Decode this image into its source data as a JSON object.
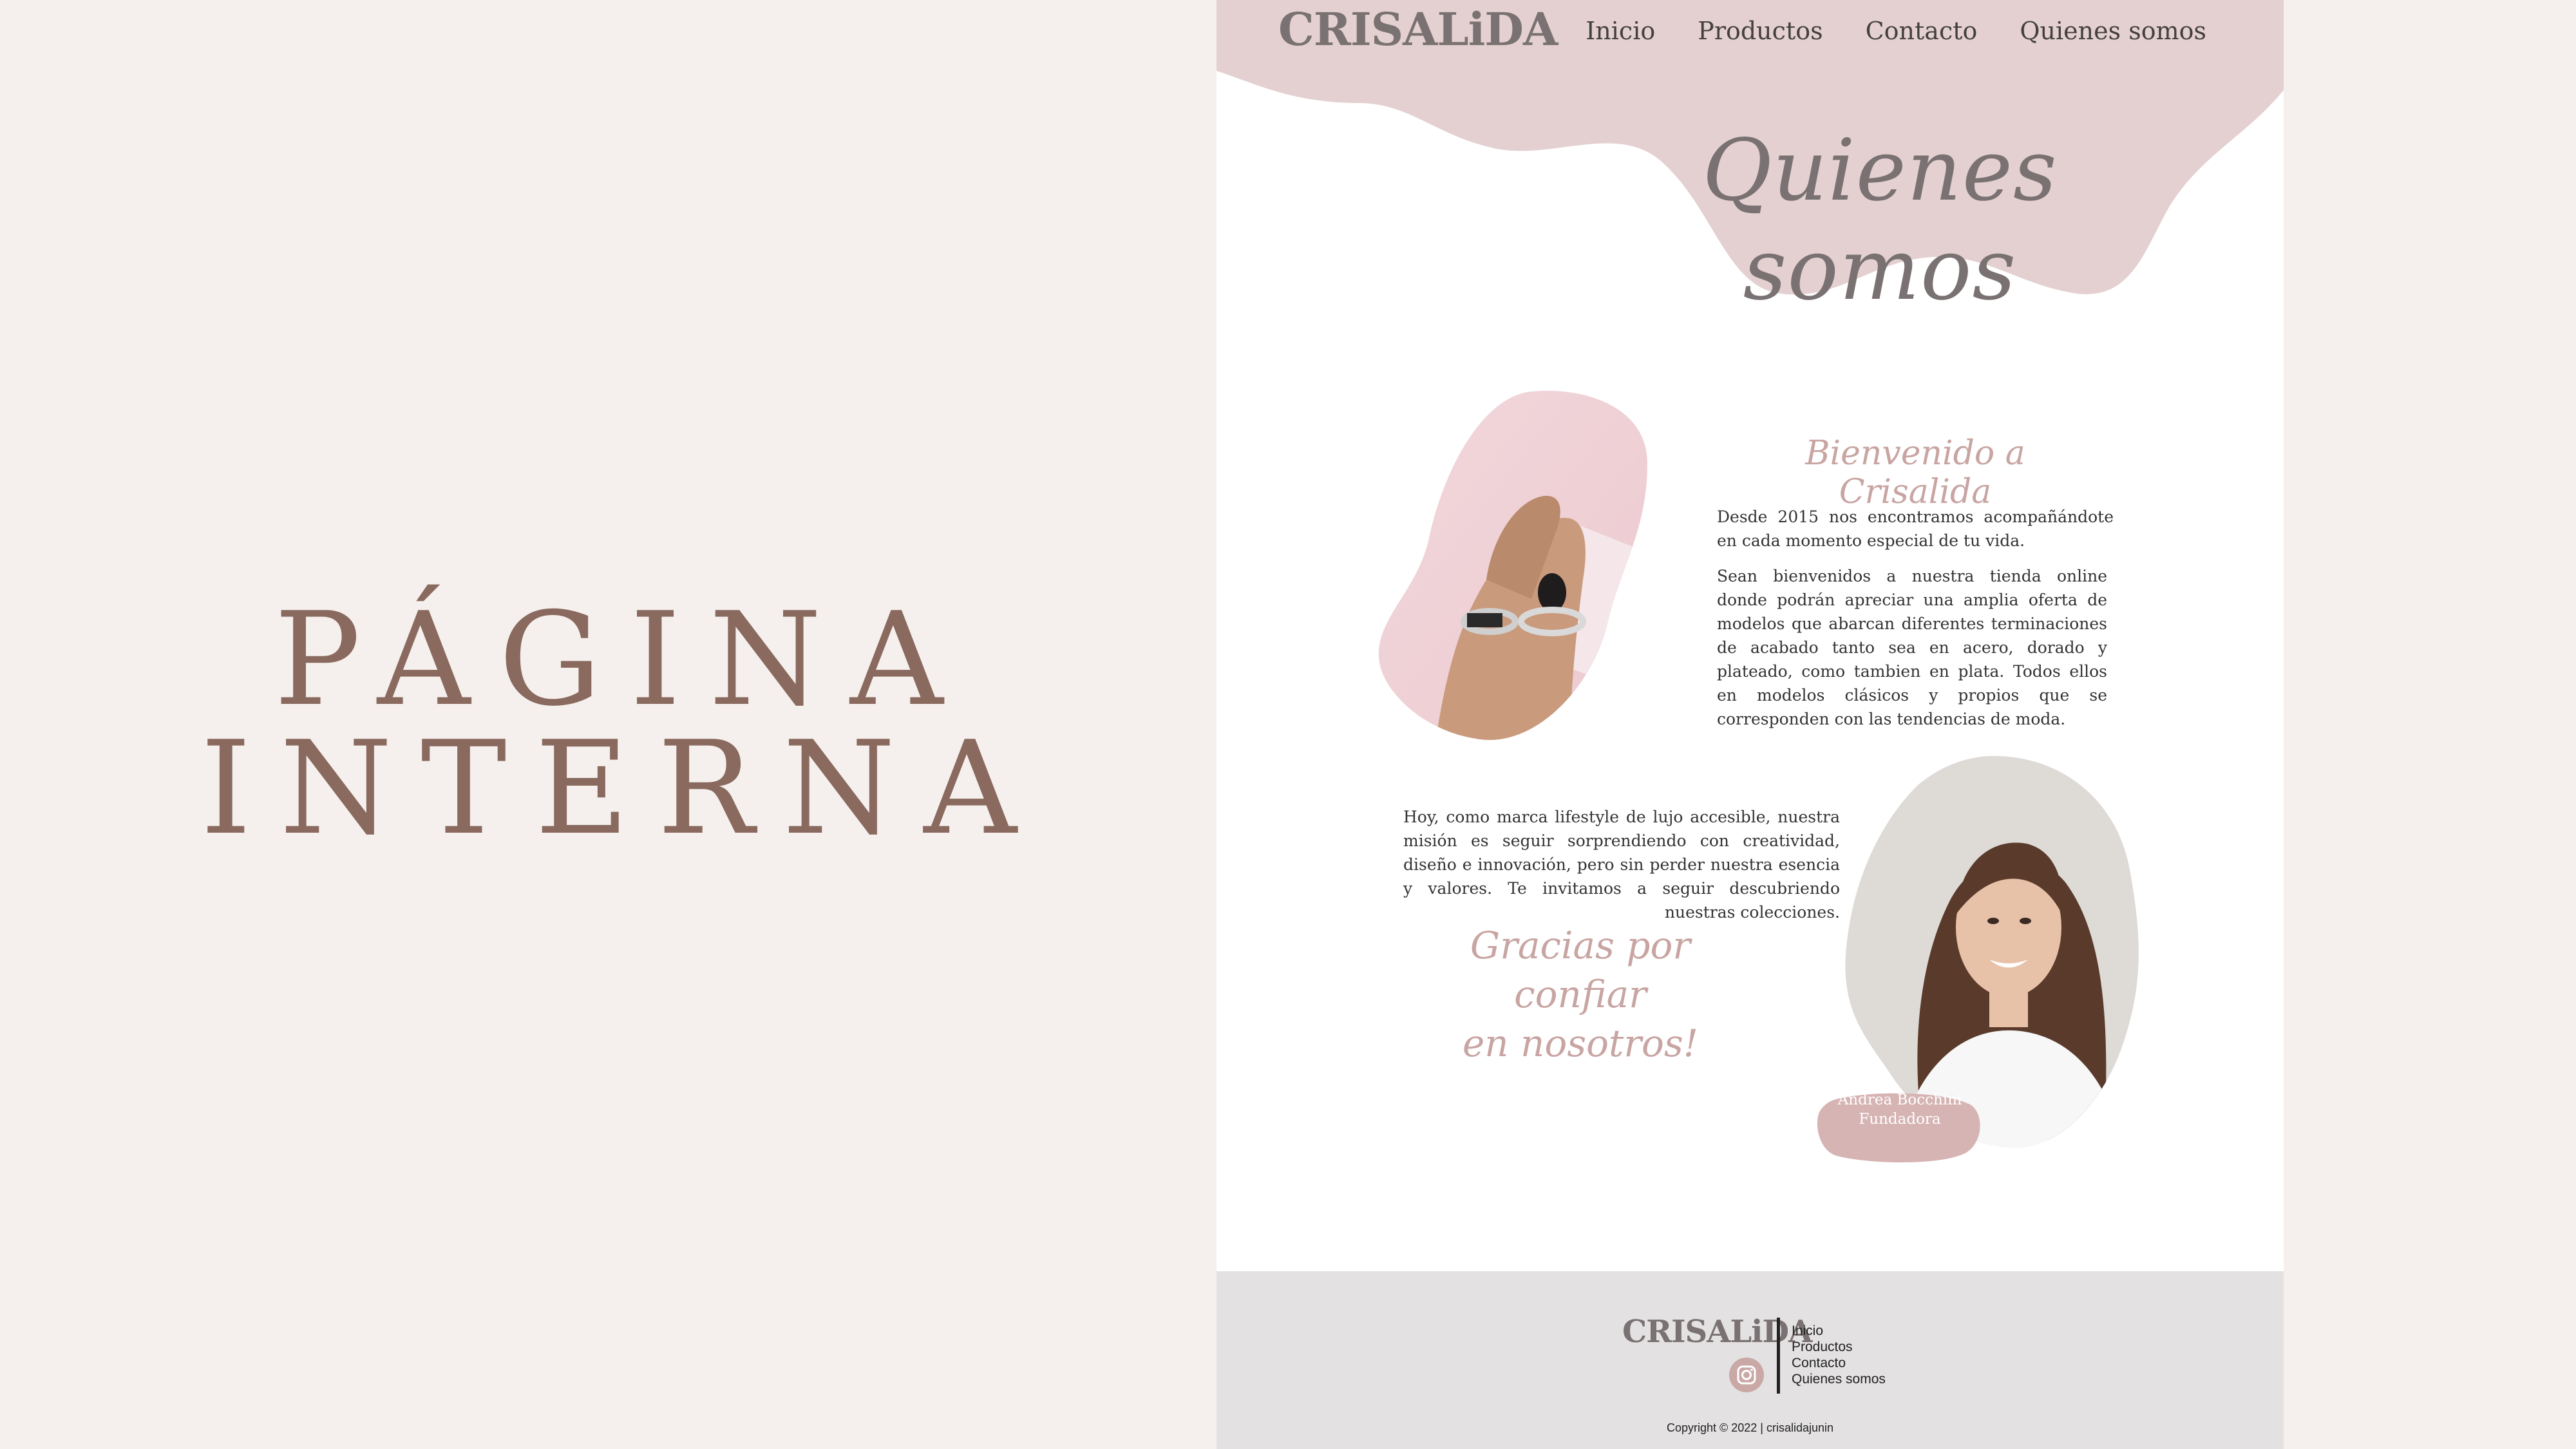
{
  "slide": {
    "title_line1": "PÁGINA",
    "title_line2": "INTERNA"
  },
  "site": {
    "logo": "CRISALiDA",
    "nav": [
      "Inicio",
      "Productos",
      "Contacto",
      "Quienes somos"
    ],
    "hero_title": "Quienes somos",
    "welcome_heading": "Bienvenido a Crisalida",
    "paragraph1": "Desde 2015 nos encontramos acompañándote en cada momento especial de tu vida.",
    "paragraph2": "Sean bienvenidos a nuestra tienda online donde podrán apreciar una amplia oferta de modelos que abarcan diferentes terminaciones de acabado tanto sea en acero, dorado y plateado, como tambien en plata. Todos ellos en modelos clásicos y propios que se corresponden con las tendencias de moda.",
    "paragraph3": "Hoy, como marca lifestyle de lujo accesible, nuestra misión es seguir sorprendiendo con creatividad, diseño e innovación, pero sin perder nuestra esencia y valores. Te invitamos a seguir descubriendo nuestras colecciones.",
    "thanks_line1": "Gracias por confiar",
    "thanks_line2": "en nosotros!",
    "founder_name": "Andrea Bocchini",
    "founder_role": "Fundadora",
    "footer": {
      "logo": "CRISALiDA",
      "links": [
        "Inicio",
        "Productos",
        "Contacto",
        "Quienes somos"
      ],
      "social_icon": "instagram-icon",
      "copyright": "Copyright © 2022 | crisalidajunin"
    }
  },
  "colors": {
    "background": "#f5f0ed",
    "title": "#8a6a5e",
    "blob": "#e4d0d0",
    "script_accent": "#c8a5a2",
    "footer_bg": "#e3e1e1"
  }
}
